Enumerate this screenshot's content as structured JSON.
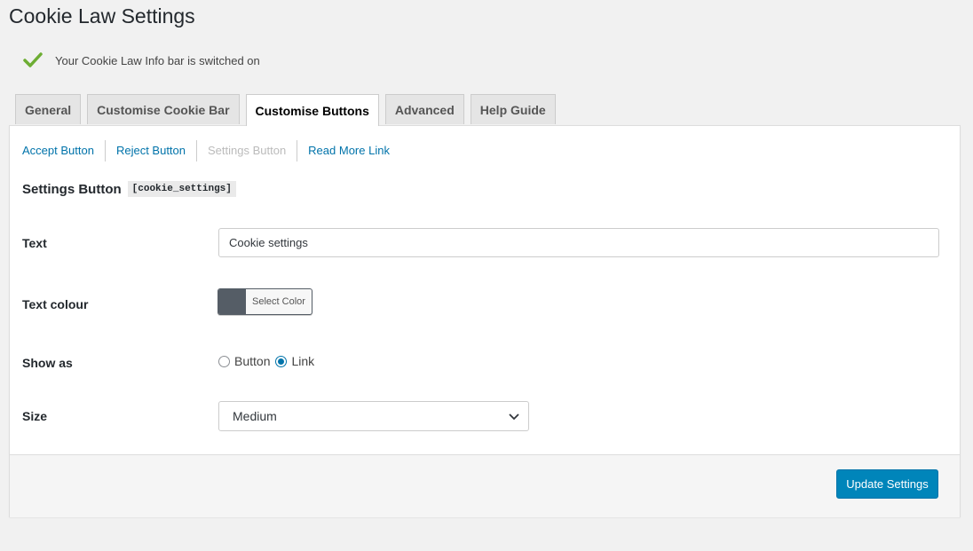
{
  "page": {
    "title": "Cookie Law Settings"
  },
  "status": {
    "message": "Your Cookie Law Info bar is switched on",
    "icon": "check-icon",
    "color": "#6dad33"
  },
  "tabs": [
    {
      "label": "General",
      "active": false
    },
    {
      "label": "Customise Cookie Bar",
      "active": false
    },
    {
      "label": "Customise Buttons",
      "active": true
    },
    {
      "label": "Advanced",
      "active": false
    },
    {
      "label": "Help Guide",
      "active": false
    }
  ],
  "subnav": [
    {
      "label": "Accept Button",
      "current": false
    },
    {
      "label": "Reject Button",
      "current": false
    },
    {
      "label": "Settings Button",
      "current": true
    },
    {
      "label": "Read More Link",
      "current": false
    }
  ],
  "section": {
    "title": "Settings Button",
    "shortcode": "[cookie_settings]"
  },
  "fields": {
    "text": {
      "label": "Text",
      "value": "Cookie settings"
    },
    "text_colour": {
      "label": "Text colour",
      "button_label": "Select Color",
      "swatch_color": "#555d66"
    },
    "show_as": {
      "label": "Show as",
      "options": [
        {
          "label": "Button",
          "checked": false
        },
        {
          "label": "Link",
          "checked": true
        }
      ]
    },
    "size": {
      "label": "Size",
      "selected": "Medium"
    }
  },
  "footer": {
    "update_label": "Update Settings"
  },
  "colors": {
    "accent": "#0085ba",
    "link": "#0073aa"
  }
}
